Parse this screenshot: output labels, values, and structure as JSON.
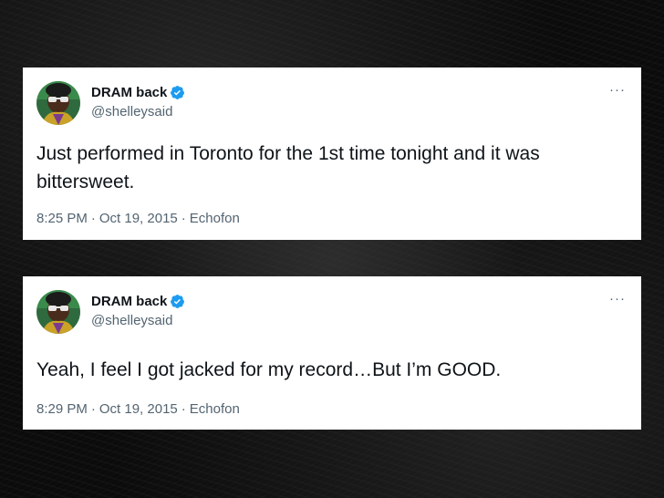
{
  "tweets": [
    {
      "display_name": "DRAM back",
      "handle": "@shelleysaid",
      "more_label": "···",
      "text": "Just performed in Toronto for the 1st time tonight and it was bittersweet.",
      "time": "8:25 PM",
      "date": "Oct 19, 2015",
      "source": "Echofon",
      "separator": "·"
    },
    {
      "display_name": "DRAM back",
      "handle": "@shelleysaid",
      "more_label": "···",
      "text": "Yeah, I feel I got jacked for my record…But I’m GOOD.",
      "time": "8:29 PM",
      "date": "Oct 19, 2015",
      "source": "Echofon",
      "separator": "·"
    }
  ],
  "colors": {
    "verified": "#1d9bf0",
    "text_primary": "#0f1419",
    "text_secondary": "#536471",
    "background": "#0b0b0b",
    "card": "#ffffff"
  },
  "icons": {
    "avatar": "avatar",
    "verified": "verified-badge-icon",
    "more": "more-options-icon"
  }
}
